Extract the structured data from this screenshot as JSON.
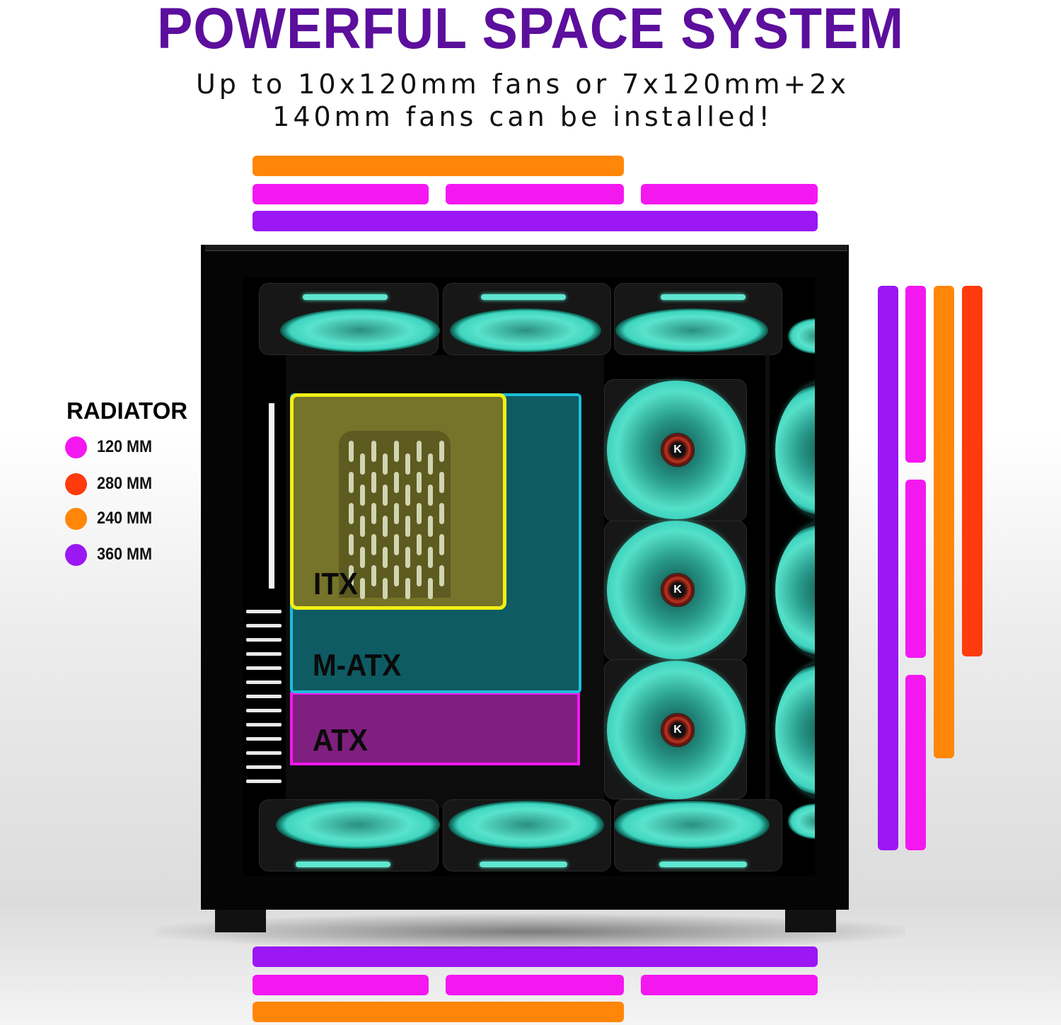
{
  "header": {
    "title": "POWERFUL SPACE SYSTEM",
    "subtitle_line1": "Up to 10x120mm fans or 7x120mm+2x",
    "subtitle_line2": "140mm fans can be installed!"
  },
  "legend": {
    "title": "RADIATOR",
    "items": [
      {
        "label": "120 MM",
        "color": "#f418f0"
      },
      {
        "label": "280 MM",
        "color": "#ff3a0c"
      },
      {
        "label": "240 MM",
        "color": "#ff8608"
      },
      {
        "label": "360 MM",
        "color": "#9b17f3"
      }
    ]
  },
  "boards": {
    "itx": "ITX",
    "matx": "M-ATX",
    "atx": "ATX"
  },
  "colors": {
    "title": "#5b0f9c",
    "r120": "#f418f0",
    "r280": "#ff3a0c",
    "r240": "#ff8608",
    "r360": "#9b17f3",
    "itx_border": "#f2f012",
    "matx_border": "#1bbfd8",
    "atx_border": "#f418f0"
  },
  "fan_logo": "K"
}
